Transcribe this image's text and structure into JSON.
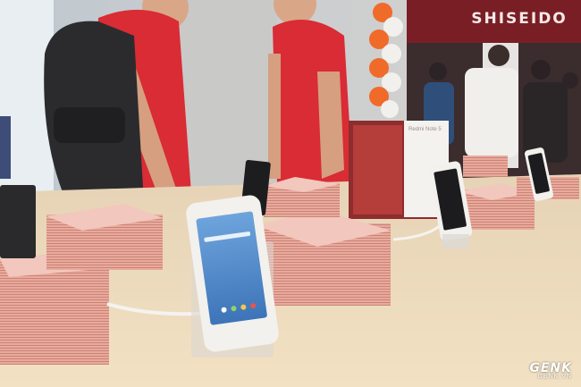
{
  "scene": {
    "store_sign": "SHISEIDO",
    "display_card_text": "Redmi Note 5",
    "watermark": {
      "brand": "GENK",
      "url": "GENK.VN"
    },
    "colors": {
      "staff_shirt": "#d92c34",
      "table_top": "#ecd8bb",
      "card_stack": "#e8a89e",
      "phone_white": "#f2f1ee",
      "phone_screen": "#4f86c8",
      "balloons": "#f06a2a"
    }
  }
}
